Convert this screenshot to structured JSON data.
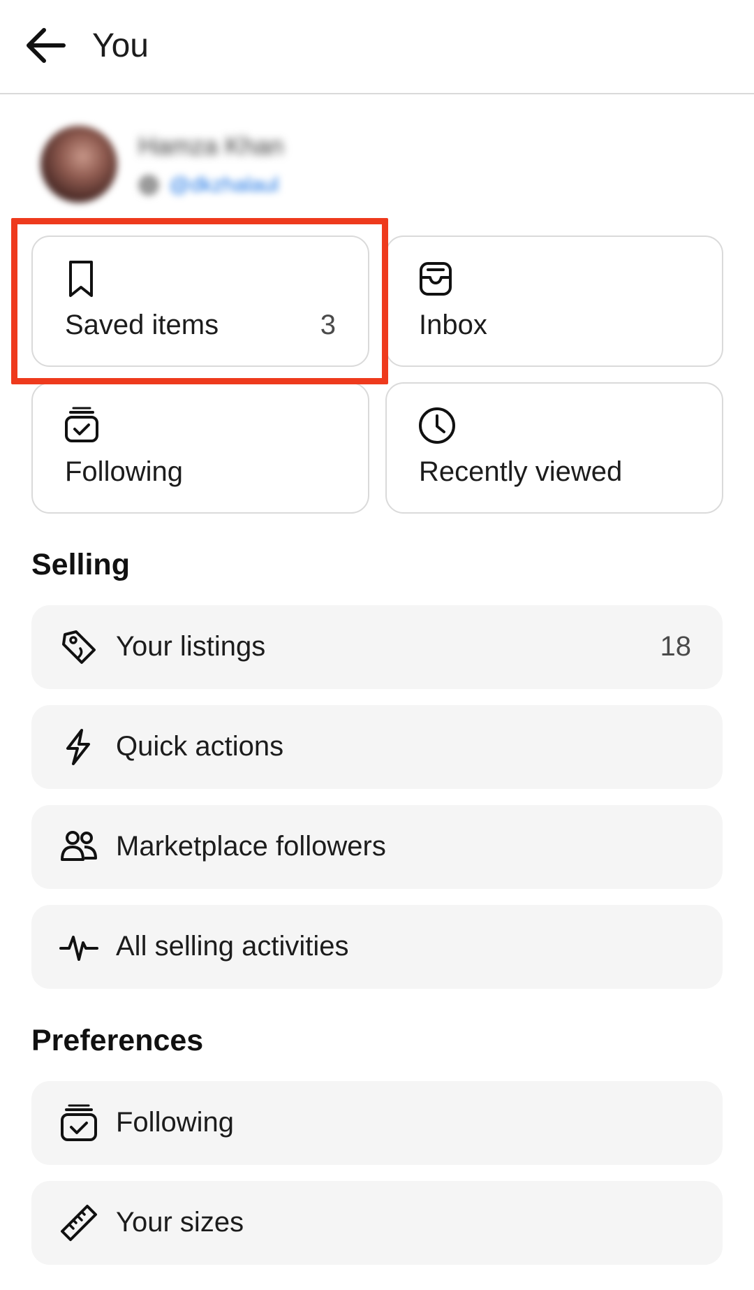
{
  "header": {
    "title": "You",
    "back_icon": "arrow-left-icon"
  },
  "profile": {
    "name": "Hamza Khan",
    "handle": "@dkzhalaul"
  },
  "tiles": [
    {
      "label": "Saved items",
      "count": "3",
      "icon": "bookmark-icon"
    },
    {
      "label": "Inbox",
      "count": "",
      "icon": "inbox-icon"
    },
    {
      "label": "Following",
      "count": "",
      "icon": "following-box-icon"
    },
    {
      "label": "Recently viewed",
      "count": "",
      "icon": "clock-icon"
    }
  ],
  "selling": {
    "title": "Selling",
    "items": [
      {
        "label": "Your listings",
        "count": "18",
        "icon": "tag-icon"
      },
      {
        "label": "Quick actions",
        "count": "",
        "icon": "lightning-icon"
      },
      {
        "label": "Marketplace followers",
        "count": "",
        "icon": "people-icon"
      },
      {
        "label": "All selling activities",
        "count": "",
        "icon": "activity-icon"
      }
    ]
  },
  "preferences": {
    "title": "Preferences",
    "items": [
      {
        "label": "Following",
        "count": "",
        "icon": "following-box-icon"
      },
      {
        "label": "Your sizes",
        "count": "",
        "icon": "ruler-icon"
      }
    ]
  },
  "colors": {
    "highlight": "#ee3a1d",
    "row_background": "#f5f5f5",
    "tile_border": "#dadada",
    "link": "#1b74e4"
  }
}
